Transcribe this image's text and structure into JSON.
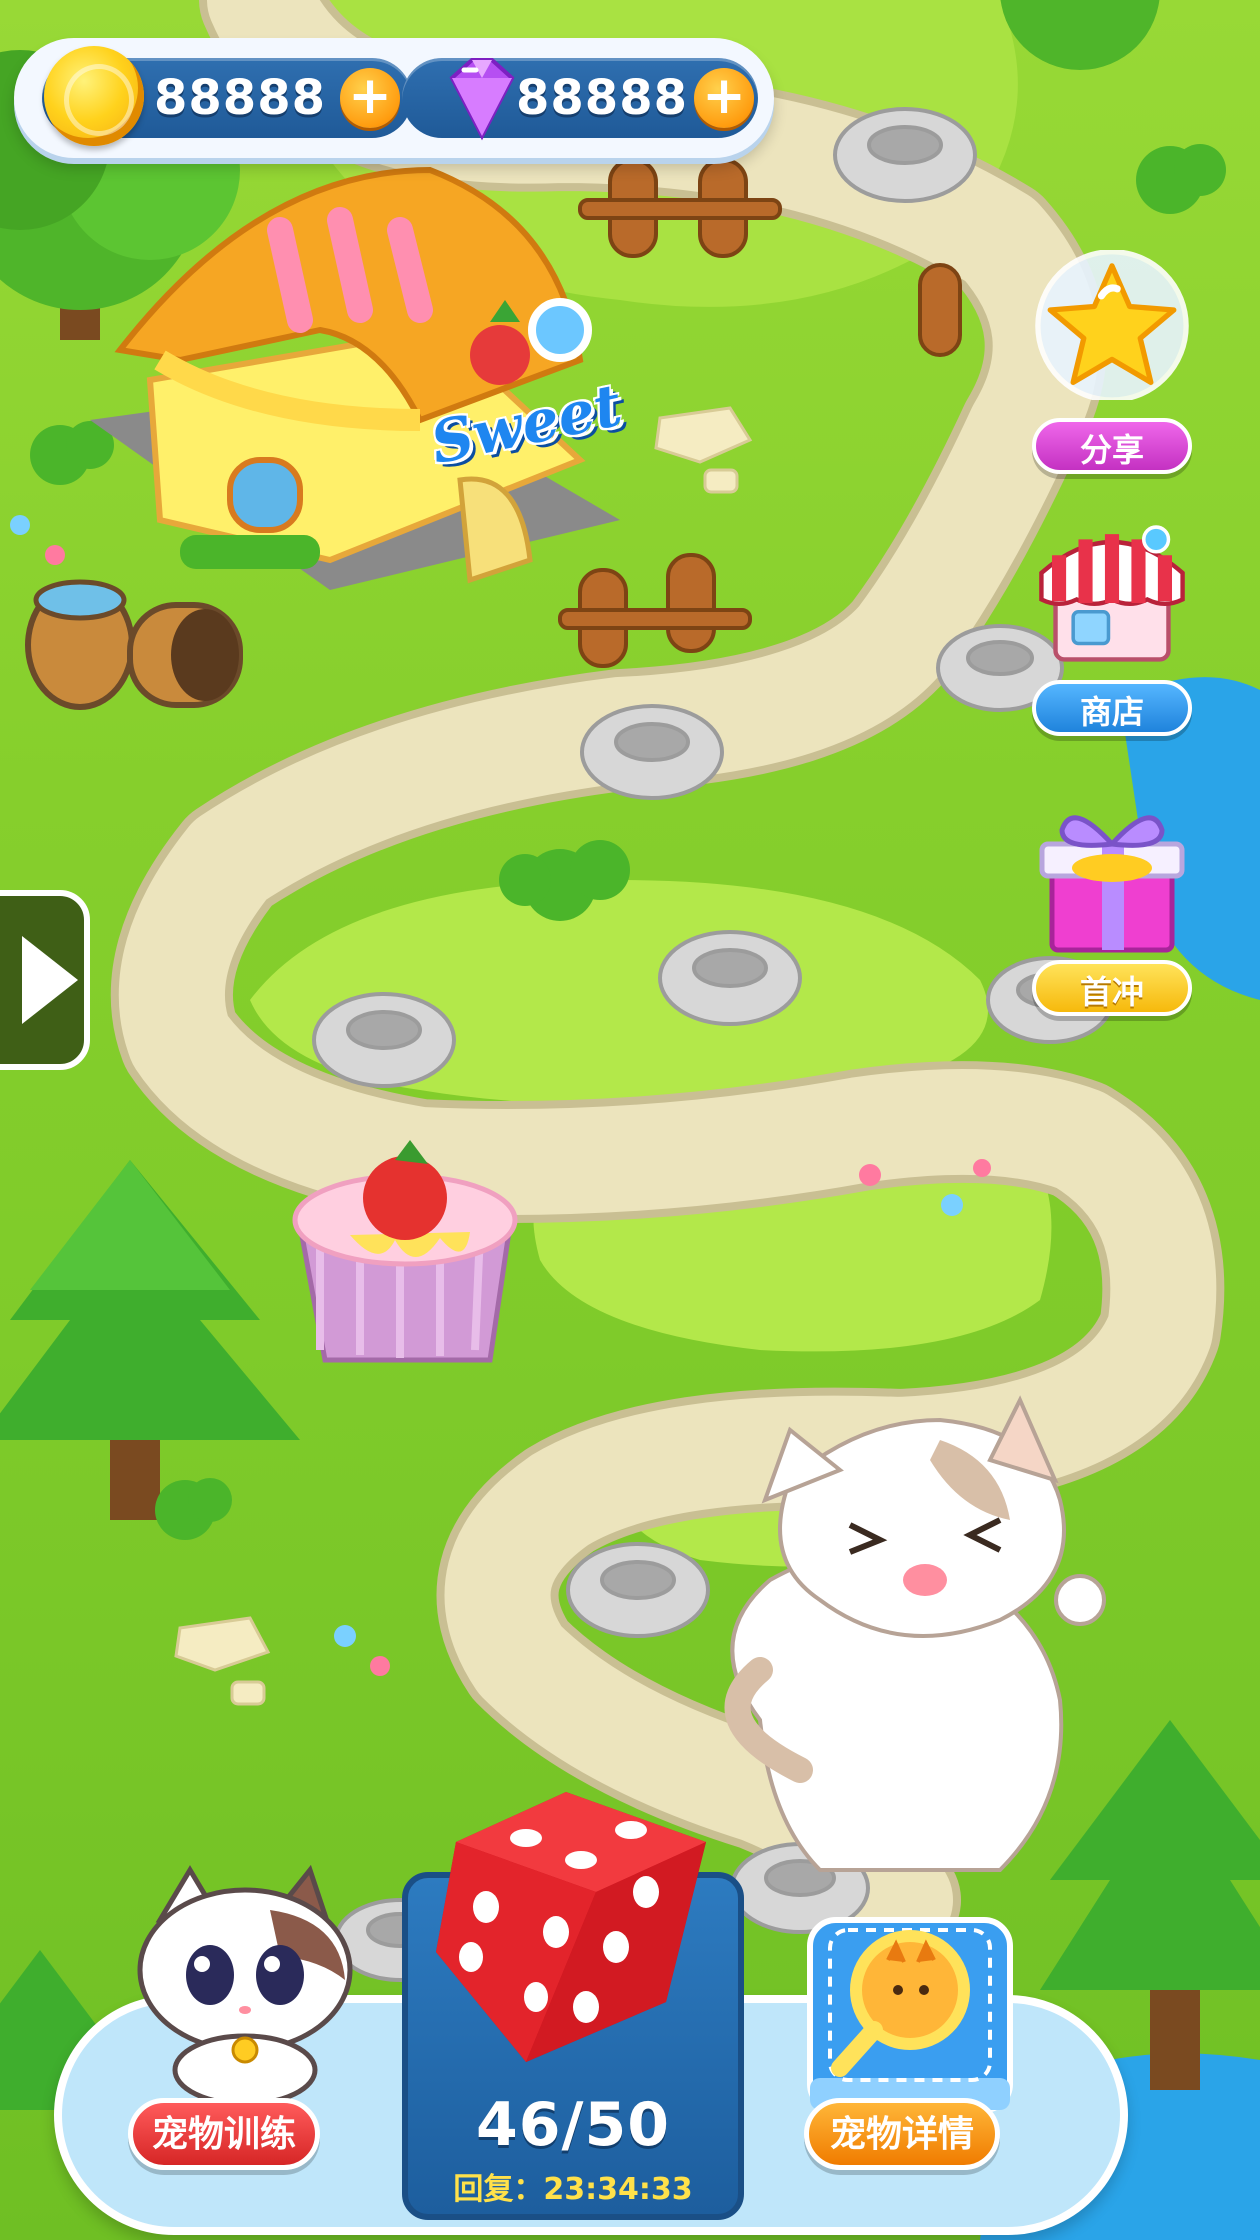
{
  "currency": {
    "coins": "88888",
    "gems": "88888",
    "plus_symbol": "+"
  },
  "shop_sign": "Sweet",
  "side_menu": {
    "share_label": "分享",
    "shop_label": "商店",
    "first_recharge_label": "首冲"
  },
  "bottom_bar": {
    "pet_train_label": "宠物训练",
    "pet_detail_label": "宠物详情",
    "energy_count": "46/50",
    "recover_label": "回复：",
    "recover_time": "23:34:33"
  },
  "colors": {
    "grass": "#86cf2c",
    "path": "#e9e2b8",
    "panel_blue": "#2d7bc0",
    "bar_light_blue": "#bfe6fa",
    "dice_red": "#e3242b"
  },
  "icons": [
    "coin-icon",
    "gem-icon",
    "plus-icon",
    "star-icon",
    "shop-awning-icon",
    "gift-box-icon",
    "dice-icon",
    "cat-avatar-icon",
    "magnifier-cat-icon",
    "arrow-right-icon"
  ]
}
